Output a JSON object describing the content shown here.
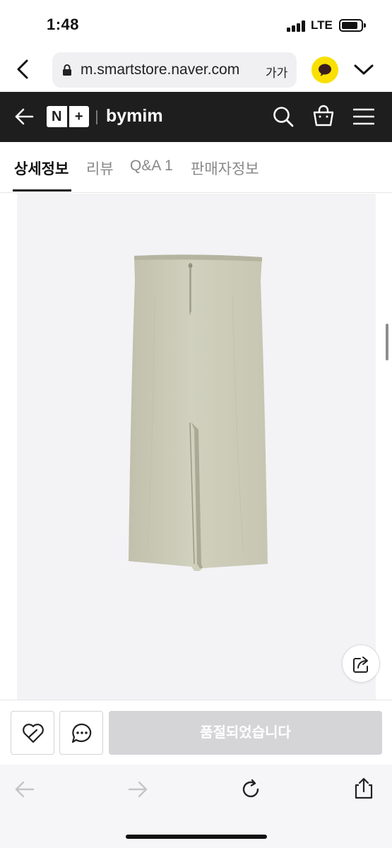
{
  "status_bar": {
    "time": "1:48",
    "network": "LTE",
    "battery_level": 0.85
  },
  "address_bar": {
    "url": "m.smartstore.naver.com",
    "text_size_label": "가가"
  },
  "store_header": {
    "logo": "N+",
    "store_name": "bymim"
  },
  "tabs": [
    {
      "label": "상세정보",
      "active": true
    },
    {
      "label": "리뷰",
      "active": false
    },
    {
      "label": "Q&A 1",
      "active": false
    },
    {
      "label": "판매자정보",
      "active": false
    }
  ],
  "product": {
    "image": "skirt-product-image",
    "background_color": "#f3f3f6",
    "skirt_color": "#c9c9b5"
  },
  "purchase_bar": {
    "soldout_label": "품절되었습니다",
    "soldout_color": "#d5d5d8"
  },
  "colors": {
    "header_bg": "#1e1e1e",
    "kakao_yellow": "#f9e000"
  },
  "icons": {
    "back": "arrow-left-icon",
    "lock": "lock-icon",
    "kakao": "kakaotalk-icon",
    "search": "search-icon",
    "bag": "shopping-bag-icon",
    "menu": "hamburger-menu-icon",
    "share": "share-icon",
    "wish": "heart-icon",
    "talk": "chat-bubble-icon",
    "refresh": "refresh-icon"
  }
}
